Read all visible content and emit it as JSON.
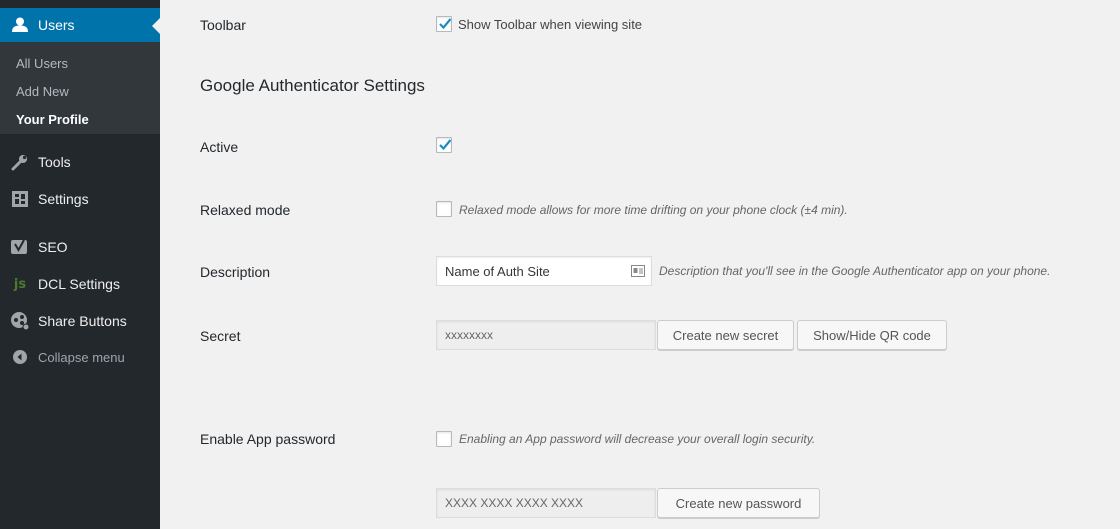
{
  "sidebar": {
    "users_label": "Users",
    "submenu": [
      "All Users",
      "Add New",
      "Your Profile"
    ],
    "tools_label": "Tools",
    "settings_label": "Settings",
    "seo_label": "SEO",
    "dcl_label": "DCL Settings",
    "share_label": "Share Buttons",
    "collapse_label": "Collapse menu"
  },
  "toolbar": {
    "label": "Toolbar",
    "checkbox_text": "Show Toolbar when viewing site",
    "checked": true
  },
  "ga": {
    "heading": "Google Authenticator Settings",
    "active_label": "Active",
    "active_checked": true,
    "relaxed_label": "Relaxed mode",
    "relaxed_desc": "Relaxed mode allows for more time drifting on your phone clock (±4 min).",
    "relaxed_checked": false,
    "description_label": "Description",
    "description_value": "Name of Auth Site",
    "description_help": "Description that you'll see in the Google Authenticator app on your phone.",
    "secret_label": "Secret",
    "secret_value": "xxxxxxxx",
    "create_secret_btn": "Create new secret",
    "qr_btn": "Show/Hide QR code",
    "app_password_label": "Enable App password",
    "app_password_desc": "Enabling an App password will decrease your overall login security.",
    "app_password_checked": false,
    "app_password_value": "XXXX XXXX XXXX XXXX",
    "create_password_btn": "Create new password"
  },
  "colors": {
    "sidebar_bg": "#23282d",
    "accent": "#0073aa",
    "checkmark": "#1e8cbe"
  }
}
